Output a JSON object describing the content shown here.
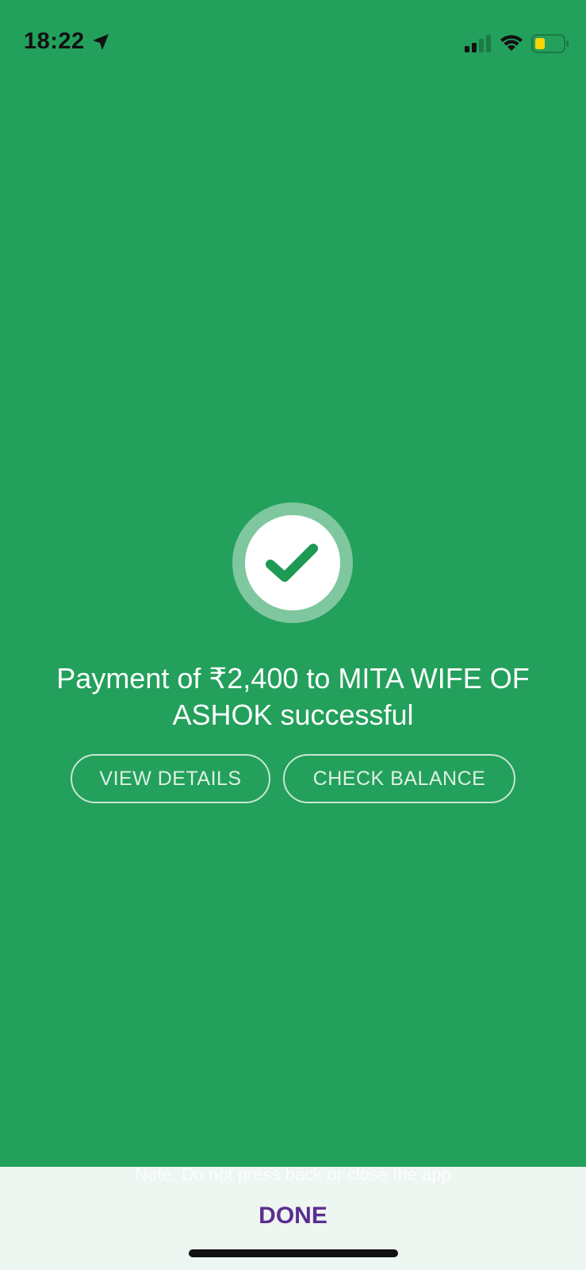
{
  "status_bar": {
    "time": "18:22",
    "icons": [
      "location-arrow-icon",
      "cellular-signal-icon",
      "wifi-icon",
      "battery-icon"
    ]
  },
  "success": {
    "icon": "check-icon",
    "message": "Payment of ₹2,400 to MITA WIFE OF ASHOK successful"
  },
  "actions": {
    "view_details_label": "VIEW DETAILS",
    "check_balance_label": "CHECK BALANCE"
  },
  "footer": {
    "note": "Note: Do not press back or close the app",
    "done_label": "DONE"
  },
  "colors": {
    "background": "#23a05b",
    "accent_done": "#5b2e91",
    "check_mark": "#1e9a55",
    "footer_bg": "#eef6f1"
  }
}
